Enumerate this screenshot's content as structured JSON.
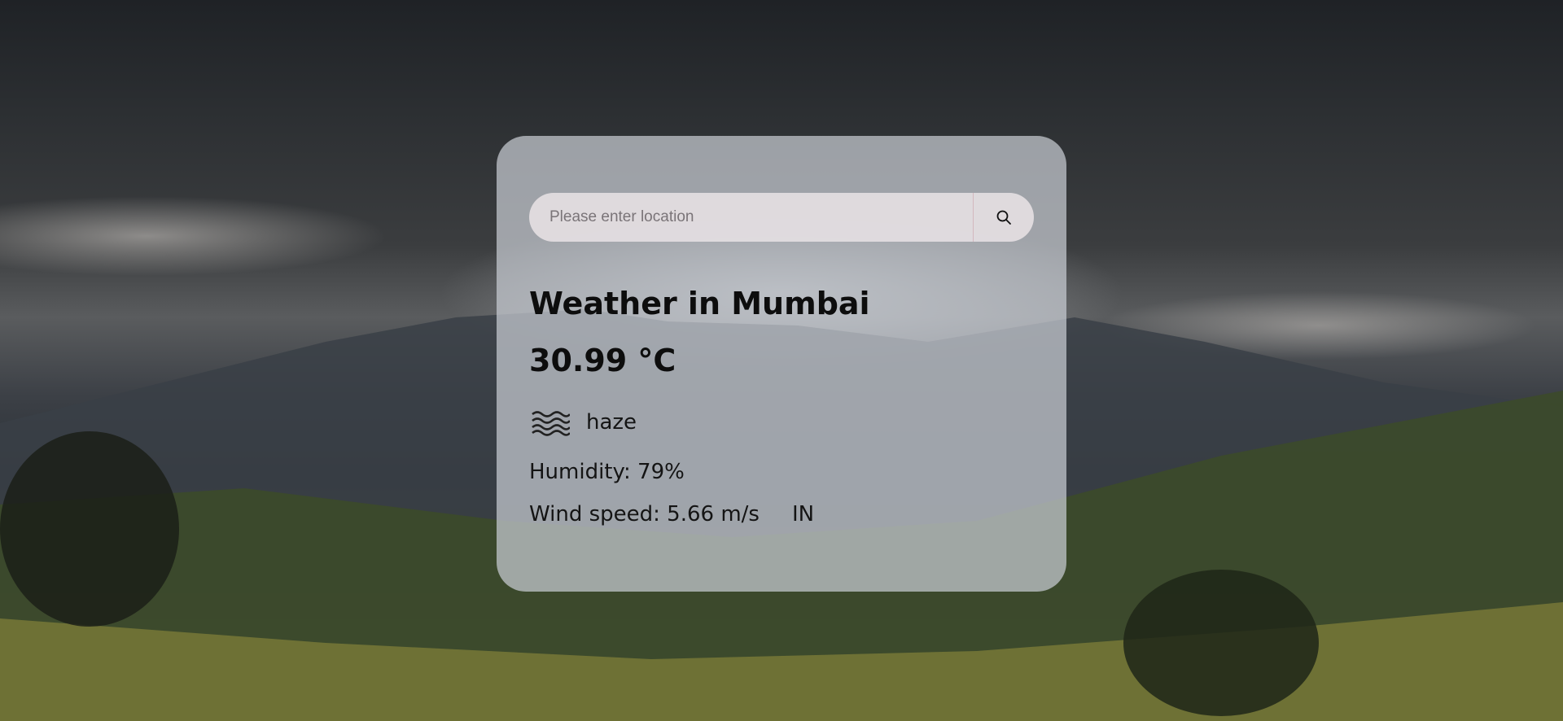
{
  "search": {
    "placeholder": "Please enter location",
    "value": "",
    "button_icon": "search-icon"
  },
  "weather": {
    "title": "Weather in Mumbai",
    "temperature": "30.99 °C",
    "condition_icon": "haze-icon",
    "condition": "haze",
    "humidity": "Humidity: 79%",
    "wind": "Wind speed: 5.66 m/s",
    "country": "IN"
  },
  "colors": {
    "card": "#c8ccd2",
    "search_bg": "#e4dee2",
    "text": "#0d0d0d"
  }
}
